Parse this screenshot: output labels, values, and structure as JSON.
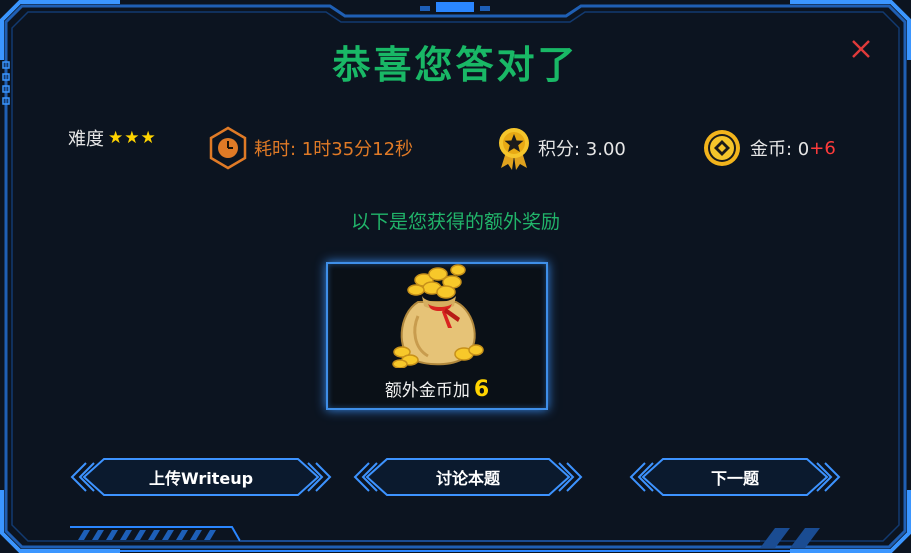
{
  "dialog": {
    "title": "恭喜您答对了",
    "close_icon": "close-icon"
  },
  "stats": {
    "difficulty_label": "难度",
    "difficulty_stars": "★★★",
    "difficulty_rating": 3,
    "time_text": "耗时: 1时35分12秒",
    "score_text": "积分: 3.00",
    "coins_label": "金币: 0",
    "coins_bonus": "+6"
  },
  "reward": {
    "subtitle": "以下是您获得的额外奖励",
    "label": "额外金币加",
    "value": "6",
    "icon": "coin-bag-icon"
  },
  "buttons": {
    "upload": "上传Writeup",
    "discuss": "讨论本题",
    "next": "下一题"
  },
  "colors": {
    "title": "#19b866",
    "frame": "#2f7fd8",
    "time": "#e07a26",
    "stars": "#ffd400",
    "bonus": "#ff3b3b"
  }
}
